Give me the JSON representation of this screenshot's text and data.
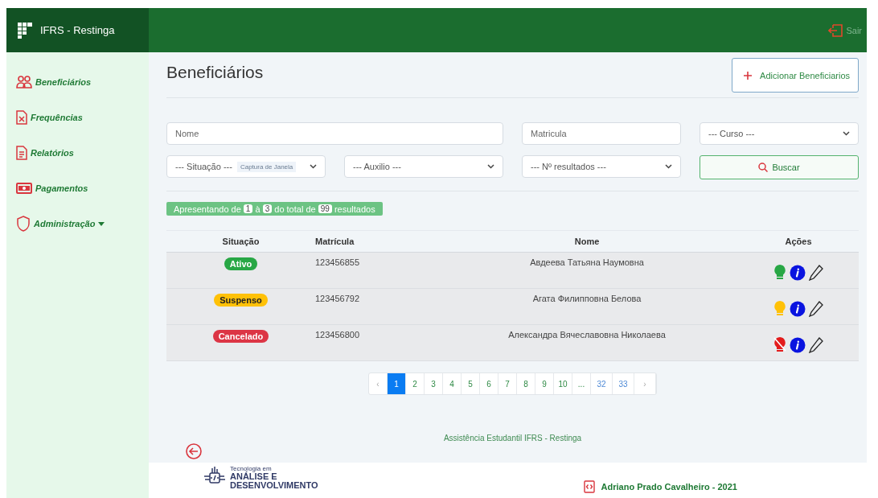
{
  "header": {
    "brand": "IFRS - Restinga",
    "logout": "Sair"
  },
  "sidebar": {
    "items": [
      {
        "label": "Beneficiários",
        "kind": "link"
      },
      {
        "label": "Frequências",
        "kind": "link"
      },
      {
        "label": "Relatórios",
        "kind": "link"
      },
      {
        "label": "Pagamentos",
        "kind": "link"
      },
      {
        "label": "Administração",
        "kind": "dropdown"
      }
    ]
  },
  "page": {
    "title": "Beneficiários",
    "add_button": "Adicionar Beneficiarios"
  },
  "filters": {
    "name": {
      "placeholder": "Nome"
    },
    "matricula": {
      "placeholder": "Matricula"
    },
    "curso": {
      "value": "--- Curso ---"
    },
    "situacao": {
      "value": "--- Situação ---"
    },
    "capture_chip": "Captura de Janela",
    "auxilio": {
      "value": "--- Auxilio ---"
    },
    "resultados": {
      "value": "--- Nº resultados ---"
    },
    "search_button": "Buscar"
  },
  "summary": {
    "parts": [
      {
        "kind": "text",
        "text": "Apresentando de"
      },
      {
        "kind": "count",
        "text": "1"
      },
      {
        "kind": "text",
        "text": "à"
      },
      {
        "kind": "count",
        "text": "3"
      },
      {
        "kind": "text",
        "text": "do total de"
      },
      {
        "kind": "count",
        "text": "99"
      },
      {
        "kind": "text",
        "text": "resultados"
      }
    ]
  },
  "table": {
    "columns": [
      "Situação",
      "Matrícula",
      "Nome",
      "Ações"
    ],
    "rows": [
      {
        "status": "Ativo",
        "color": "#28a745",
        "matricula": "123456855",
        "name": "Авдеева Татьяна Наумовна",
        "light_on": true
      },
      {
        "status": "Suspenso",
        "color": "#ffc107",
        "matricula": "123456792",
        "name": "Агата Филипповна Белова",
        "light_on": true
      },
      {
        "status": "Cancelado",
        "color": "#dc3545",
        "matricula": "123456800",
        "name": "Александра Вячеславовна Николаева",
        "light_on": false
      }
    ]
  },
  "pagination": {
    "items": [
      {
        "label": "‹",
        "selected": false
      },
      {
        "label": "1",
        "selected": true
      },
      {
        "label": "2",
        "selected": false
      },
      {
        "label": "3",
        "selected": false
      },
      {
        "label": "4",
        "selected": false
      },
      {
        "label": "5",
        "selected": false
      },
      {
        "label": "6",
        "selected": false
      },
      {
        "label": "7",
        "selected": false
      },
      {
        "label": "8",
        "selected": false
      },
      {
        "label": "9",
        "selected": false
      },
      {
        "label": "10",
        "selected": false
      },
      {
        "label": "...",
        "selected": false
      },
      {
        "label": "32",
        "selected": false
      },
      {
        "label": "33",
        "selected": false
      },
      {
        "label": "›",
        "selected": false
      }
    ]
  },
  "footer": {
    "text": "Assistência Estudantil IFRS - Restinga",
    "logo": {
      "line_1": "Tecnologia em",
      "line_2": "ANÁLISE E",
      "line_3": "DESENVOLVIMENTO"
    },
    "author": "Adriano Prado Cavalheiro - 2021"
  }
}
